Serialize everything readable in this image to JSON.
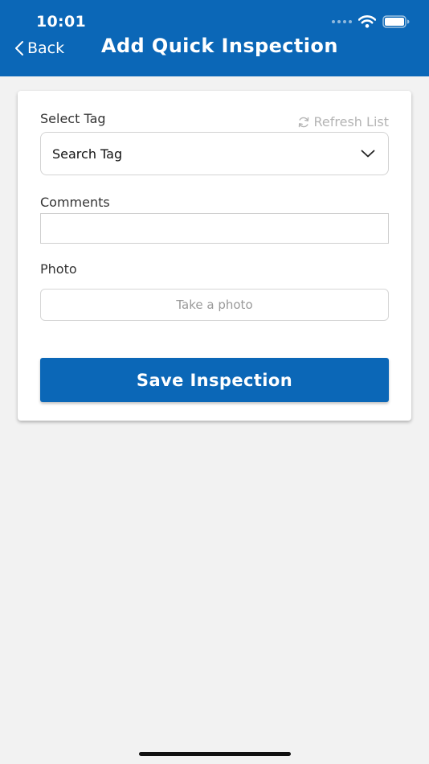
{
  "status_bar": {
    "time": "10:01",
    "icons": [
      "signal-dots-icon",
      "wifi-icon",
      "battery-icon"
    ]
  },
  "header": {
    "back_label": "Back",
    "title": "Add Quick Inspection",
    "background_color": "#0b67b7"
  },
  "form": {
    "tag": {
      "label": "Select Tag",
      "refresh_label": "Refresh List",
      "value": "Search Tag"
    },
    "comments": {
      "label": "Comments",
      "value": "",
      "placeholder": ""
    },
    "photo": {
      "label": "Photo",
      "button_label": "Take a photo"
    },
    "save_label": "Save Inspection"
  },
  "colors": {
    "accent": "#0b67b7",
    "page_background": "#f2f2f2",
    "muted_text": "#b4b4b4"
  }
}
